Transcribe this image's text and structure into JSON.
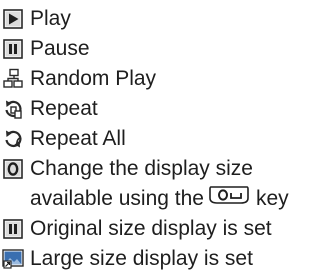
{
  "legend": {
    "items": [
      {
        "icon": "play-icon",
        "label": "Play"
      },
      {
        "icon": "pause-icon",
        "label": "Pause"
      },
      {
        "icon": "random-play-icon",
        "label": "Random Play"
      },
      {
        "icon": "repeat-icon",
        "label": "Repeat"
      },
      {
        "icon": "repeat-all-icon",
        "label": "Repeat All"
      },
      {
        "icon": "display-size-change-icon",
        "label_line1": "Change the display size",
        "label_line2_before": "available using the",
        "key_icon": "o-key-icon",
        "label_line2_after": "key"
      },
      {
        "icon": "original-size-icon",
        "label": "Original size display is set"
      },
      {
        "icon": "large-size-icon",
        "label": "Large size display is set"
      }
    ]
  },
  "colors": {
    "text": "#1e1e1e",
    "icon_dark": "#2a2a2a",
    "icon_light": "#e8e8e8",
    "icon_blue": "#3a6fb0"
  }
}
